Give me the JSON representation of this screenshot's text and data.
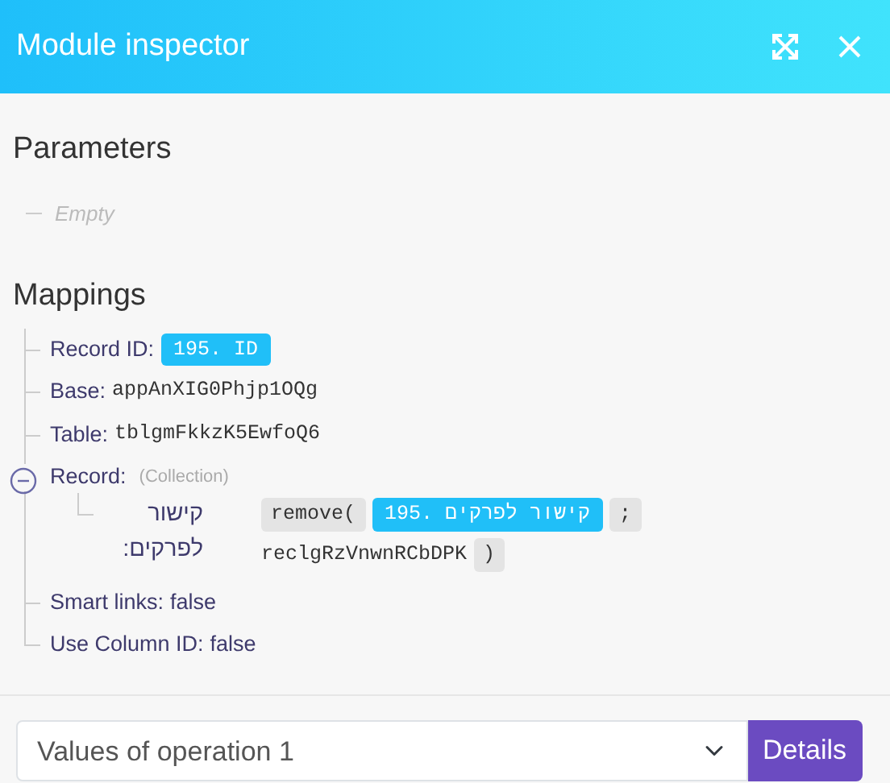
{
  "window": {
    "title": "Module inspector"
  },
  "parameters": {
    "title": "Parameters",
    "empty_text": "Empty"
  },
  "mappings": {
    "title": "Mappings",
    "items": [
      {
        "kind": "field",
        "label": "Record ID:",
        "value": [
          {
            "kind": "pill",
            "text": "195. ID"
          }
        ]
      },
      {
        "kind": "field",
        "label": "Base:",
        "value": [
          {
            "kind": "mono",
            "text": "appAnXIG0Phjp1OQg"
          }
        ]
      },
      {
        "kind": "field",
        "label": "Table:",
        "value": [
          {
            "kind": "mono",
            "text": "tblgmFkkzK5EwfoQ6"
          }
        ]
      },
      {
        "kind": "collection",
        "label": "Record:",
        "note": "(Collection)",
        "expanded": true,
        "children": [
          {
            "kind": "field",
            "label": "קישור לפרקים:",
            "value": [
              {
                "kind": "fn",
                "text": "remove("
              },
              {
                "kind": "pill",
                "text": "195. קישור לפרקים"
              },
              {
                "kind": "fn",
                "text": ";"
              },
              {
                "kind": "mono",
                "text": "reclgRzVnwnRCbDPK"
              },
              {
                "kind": "fn",
                "text": ")"
              }
            ]
          }
        ]
      },
      {
        "kind": "field",
        "label": "Smart links:",
        "value": [
          {
            "kind": "text",
            "text": "false"
          }
        ]
      },
      {
        "kind": "field",
        "label": "Use Column ID:",
        "value": [
          {
            "kind": "text",
            "text": "false"
          }
        ]
      }
    ]
  },
  "footer": {
    "select": {
      "value": "Values of operation 1"
    },
    "button": "Details"
  }
}
